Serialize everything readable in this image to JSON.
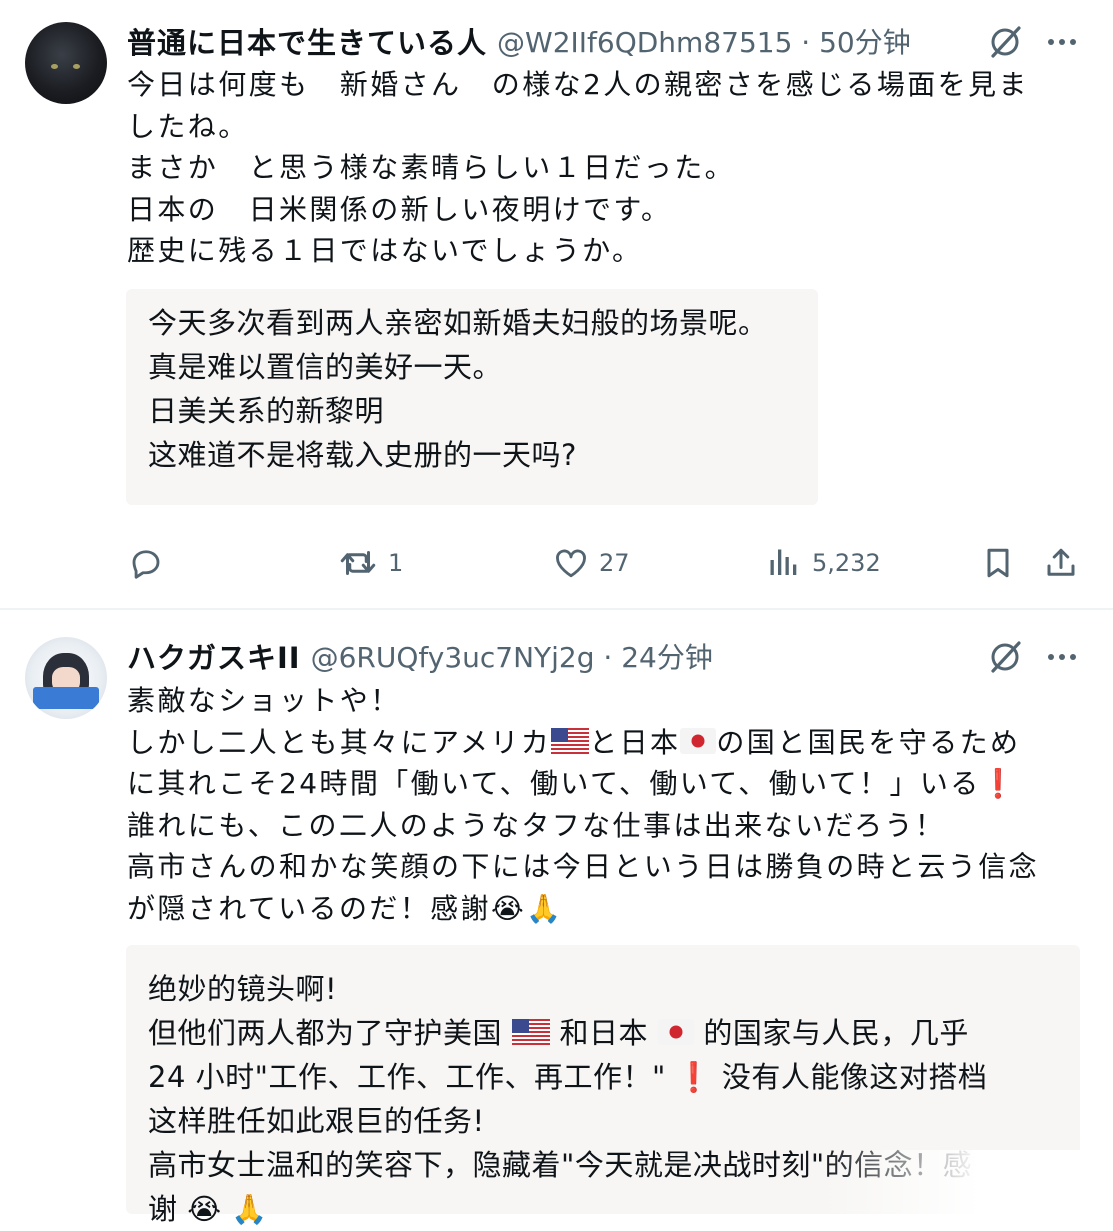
{
  "tweets": [
    {
      "name": "普通に日本で生きている人",
      "handle": "@W2IIf6QDhm87515 · 50分钟",
      "text": "今日は何度も　新婚さん　の様な2人の親密さを感じる場面を見ま\nしたね。\nまさか　と思う様な素晴らしい１日だった。\n日本の　日米関係の新しい夜明けです。\n歴史に残る１日ではないでしょうか。",
      "translation": "今天多次看到两人亲密如新婚夫妇般的场景呢。\n真是难以置信的美好一天。\n日美关系的新黎明\n这难道不是将载入史册的一天吗?",
      "stats": {
        "retweets": "1",
        "likes": "27",
        "views": "5,232"
      }
    },
    {
      "name": "ハクガスキII",
      "handle": "@6RUQfy3uc7NYj2g · 24分钟",
      "text_line1": "素敵なショットや！",
      "text_line2a": "しかし二人とも其々にアメリカ",
      "text_line2b": "と日本",
      "text_line2c": "の国と国民を守るため",
      "text_line3a": "に其れこそ24時間「働いて、働いて、働いて、働いて！」いる",
      "text_line3b": "❗",
      "text_line4": "誰れにも、この二人のようなタフな仕事は出来ないだろう！",
      "text_line5": "高市さんの和かな笑顔の下には今日という日は勝負の時と云う信念",
      "text_line6": "が隠されているのだ！感謝😭🙏",
      "trans_line1": "绝妙的镜头啊!",
      "trans_line2a": "但他们两人都为了守护美国 ",
      "trans_line2b": " 和日本 ",
      "trans_line2c": " 的国家与人民，几乎",
      "trans_line3a": "24 小时\"工作、工作、工作、再工作！\" ",
      "trans_line3b": "❗",
      "trans_line3c": " 没有人能像这对搭档",
      "trans_line4": "这样胜任如此艰巨的任务!",
      "trans_line5": "高市女士温和的笑容下，隐藏着\"今天就是决战时刻\"的信念！感",
      "trans_line6": "谢 😭 🙏"
    }
  ],
  "icons": {
    "reply": "reply-icon",
    "retweet": "retweet-icon",
    "like": "heart-icon",
    "views": "views-icon",
    "bookmark": "bookmark-icon",
    "share": "share-icon",
    "grok": "grok-icon",
    "more": "more-icon"
  }
}
